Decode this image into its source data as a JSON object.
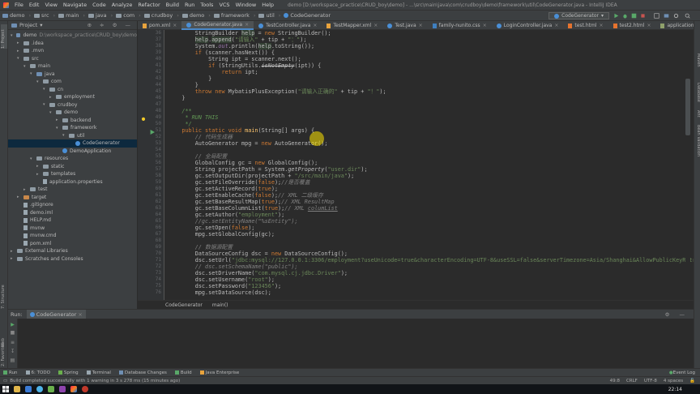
{
  "menu": {
    "items": [
      "File",
      "Edit",
      "View",
      "Navigate",
      "Code",
      "Analyze",
      "Refactor",
      "Build",
      "Run",
      "Tools",
      "VCS",
      "Window",
      "Help"
    ],
    "title": "demo [D:\\workspace_practice\\CRUD_boy\\demo] - ...\\src\\main\\java\\com\\crudboy\\demo\\framework\\util\\CodeGenerator.java - IntelliJ IDEA"
  },
  "nav": {
    "crumbs": [
      "demo",
      "src",
      "main",
      "java",
      "com",
      "crudboy",
      "demo",
      "framework",
      "util",
      "CodeGenerator"
    ],
    "run_config": "CodeGenerator"
  },
  "project": {
    "header": "Project",
    "tree": [
      {
        "label": "demo",
        "extra": "D:\\workspace_practice\\CRUD_boy\\demo",
        "depth": 0,
        "arrow": "▾",
        "icon": "folder-blue"
      },
      {
        "label": ".idea",
        "depth": 1,
        "arrow": "▸",
        "icon": "folder"
      },
      {
        "label": ".mvn",
        "depth": 1,
        "arrow": "▸",
        "icon": "folder"
      },
      {
        "label": "src",
        "depth": 1,
        "arrow": "▾",
        "icon": "folder"
      },
      {
        "label": "main",
        "depth": 2,
        "arrow": "▾",
        "icon": "folder"
      },
      {
        "label": "java",
        "depth": 3,
        "arrow": "▾",
        "icon": "folder-blue"
      },
      {
        "label": "com",
        "depth": 4,
        "arrow": "▾",
        "icon": "folder"
      },
      {
        "label": "cn",
        "depth": 5,
        "arrow": "▾",
        "icon": "folder"
      },
      {
        "label": "employment",
        "depth": 6,
        "arrow": "▸",
        "icon": "folder"
      },
      {
        "label": "crudboy",
        "depth": 5,
        "arrow": "▾",
        "icon": "folder"
      },
      {
        "label": "demo",
        "depth": 6,
        "arrow": "▾",
        "icon": "folder"
      },
      {
        "label": "backend",
        "depth": 7,
        "arrow": "▸",
        "icon": "folder"
      },
      {
        "label": "framework",
        "depth": 7,
        "arrow": "▾",
        "icon": "folder"
      },
      {
        "label": "util",
        "depth": 8,
        "arrow": "▾",
        "icon": "folder"
      },
      {
        "label": "CodeGenerator",
        "depth": 9,
        "arrow": "",
        "icon": "java",
        "selected": true
      },
      {
        "label": "DemoApplication",
        "depth": 7,
        "arrow": "",
        "icon": "java"
      },
      {
        "label": "resources",
        "depth": 3,
        "arrow": "▾",
        "icon": "folder"
      },
      {
        "label": "static",
        "depth": 4,
        "arrow": "▸",
        "icon": "folder"
      },
      {
        "label": "templates",
        "depth": 4,
        "arrow": "▸",
        "icon": "folder"
      },
      {
        "label": "application.properties",
        "depth": 4,
        "arrow": "",
        "icon": "file"
      },
      {
        "label": "test",
        "depth": 2,
        "arrow": "▸",
        "icon": "folder"
      },
      {
        "label": "target",
        "depth": 1,
        "arrow": "▸",
        "icon": "folder-orange"
      },
      {
        "label": ".gitignore",
        "depth": 1,
        "arrow": "",
        "icon": "file"
      },
      {
        "label": "demo.iml",
        "depth": 1,
        "arrow": "",
        "icon": "file"
      },
      {
        "label": "HELP.md",
        "depth": 1,
        "arrow": "",
        "icon": "file"
      },
      {
        "label": "mvnw",
        "depth": 1,
        "arrow": "",
        "icon": "file"
      },
      {
        "label": "mvnw.cmd",
        "depth": 1,
        "arrow": "",
        "icon": "file"
      },
      {
        "label": "pom.xml",
        "depth": 1,
        "arrow": "",
        "icon": "file"
      },
      {
        "label": "External Libraries",
        "depth": 0,
        "arrow": "▸",
        "icon": "folder"
      },
      {
        "label": "Scratches and Consoles",
        "depth": 0,
        "arrow": "▸",
        "icon": "folder"
      }
    ]
  },
  "tabs": [
    "pom.xml",
    "CodeGenerator.java",
    "TestController.java",
    "TestMapper.xml",
    "Test.java",
    "family-nunito.css",
    "LoginController.java",
    "test.html",
    "test2.html",
    "application.properties"
  ],
  "active_tab": 1,
  "editor": {
    "line_numbers": [
      "36",
      "37",
      "38",
      "39",
      "40",
      "41",
      "42",
      "43",
      "44",
      "45",
      "46",
      "47",
      "48",
      "49",
      "50",
      "51",
      "52",
      "53",
      "54",
      "55",
      "56",
      "57",
      "58",
      "59",
      "60",
      "61",
      "62",
      "63",
      "64",
      "65",
      "66",
      "67",
      "68",
      "69",
      "70",
      "71",
      "72",
      "73",
      "74",
      "75",
      "76"
    ],
    "breadcrumb": [
      "CodeGenerator",
      "main()"
    ]
  },
  "run": {
    "label": "Run:",
    "config_tab": "CodeGenerator"
  },
  "toolstripe": [
    "Run",
    "6: TODO",
    "Spring",
    "Terminal",
    "Database Changes",
    "Build",
    "Java Enterprise"
  ],
  "event_log": "Event Log",
  "status": {
    "message": "Build completed successfully with 1 warning in 3 s 278 ms (15 minutes ago)",
    "position": "49:8",
    "line_sep": "CRLF",
    "encoding": "UTF-8",
    "indent": "4 spaces"
  },
  "clock": "22:14"
}
